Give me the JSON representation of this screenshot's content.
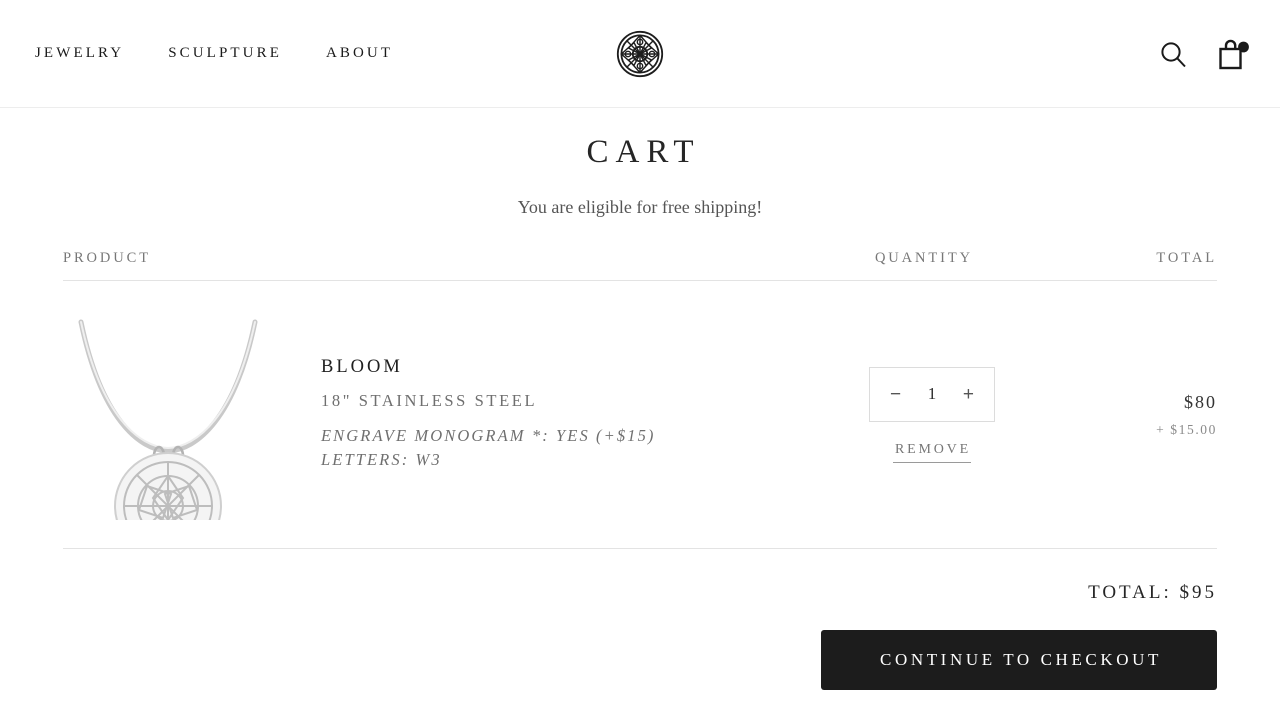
{
  "header": {
    "nav": [
      {
        "label": "JEWELRY"
      },
      {
        "label": "SCULPTURE"
      },
      {
        "label": "ABOUT"
      }
    ],
    "logo_name": "mandala-rosette-logo",
    "search_icon": "search-icon",
    "cart_icon": "shopping-bag-icon",
    "cart_has_items_badge": true
  },
  "page": {
    "title": "CART",
    "shipping_note": "You are eligible for free shipping!"
  },
  "table": {
    "headers": {
      "product": "PRODUCT",
      "quantity": "QUANTITY",
      "total": "TOTAL"
    }
  },
  "items": [
    {
      "image_alt": "silver geometric rosette pendant necklace",
      "title": "BLOOM",
      "variant": "18\" STAINLESS STEEL",
      "properties": [
        "ENGRAVE MONOGRAM *: YES (+$15)",
        "LETTERS: W3"
      ],
      "quantity": "1",
      "decrease_label": "−",
      "increase_label": "+",
      "remove_label": "REMOVE",
      "line_total": "$80",
      "line_extra": "+ $15.00"
    }
  ],
  "summary": {
    "total_label": "TOTAL: $95",
    "checkout_label": "CONTINUE TO CHECKOUT"
  },
  "colors": {
    "text": "#1a1a1a",
    "muted": "#777777",
    "rule": "#e3e3e3",
    "button_bg": "#1c1c1c"
  }
}
